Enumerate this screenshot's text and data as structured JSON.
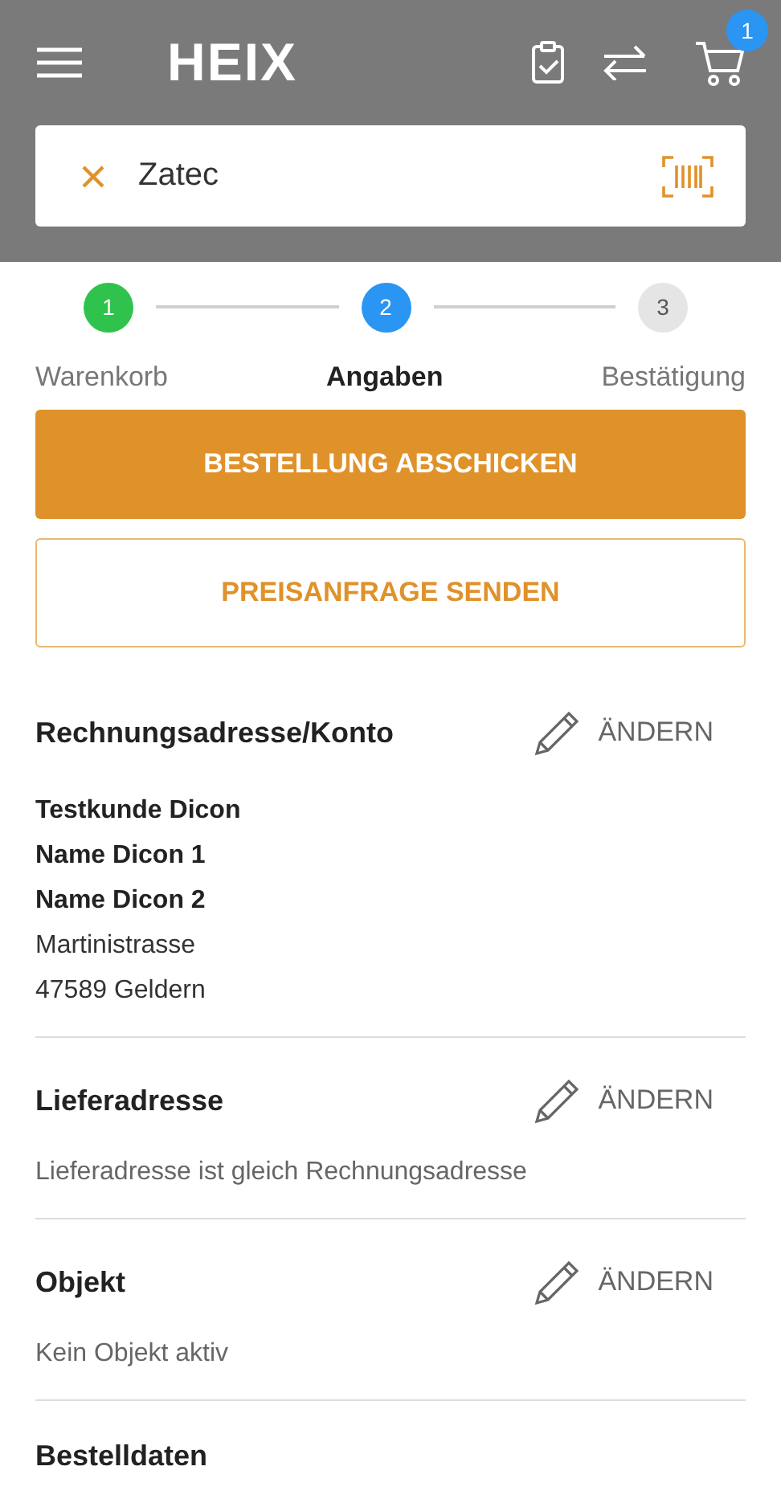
{
  "header": {
    "logo": "HEIX",
    "cart_count": "1"
  },
  "search": {
    "value": "Zatec"
  },
  "steps": [
    {
      "number": "1",
      "label": "Warenkorb",
      "kind": "done",
      "selected": false
    },
    {
      "number": "2",
      "label": "Angaben",
      "kind": "active",
      "selected": true
    },
    {
      "number": "3",
      "label": "Bestätigung",
      "kind": "pending",
      "selected": false
    }
  ],
  "buttons": [
    {
      "label": "BESTELLUNG ABSCHICKEN",
      "kind": "primary"
    },
    {
      "label": "PREISANFRAGE SENDEN",
      "kind": "outline"
    }
  ],
  "sections": [
    {
      "title": "Rechnungsadresse/Konto",
      "action": "ÄNDERN",
      "lines": [
        {
          "text": "Testkunde Dicon",
          "bold": true
        },
        {
          "text": "Name Dicon 1",
          "bold": true
        },
        {
          "text": "Name Dicon 2",
          "bold": true
        },
        {
          "text": "Martinistrasse",
          "bold": false
        },
        {
          "text": "47589 Geldern",
          "bold": false
        }
      ]
    },
    {
      "title": "Lieferadresse",
      "action": "ÄNDERN",
      "lines": [
        {
          "text": "Lieferadresse ist gleich Rechnungsadresse",
          "bold": false
        }
      ]
    },
    {
      "title": "Objekt",
      "action": "ÄNDERN",
      "lines": [
        {
          "text": "Kein Objekt aktiv",
          "bold": false
        }
      ]
    },
    {
      "title": "Bestelldaten"
    }
  ]
}
